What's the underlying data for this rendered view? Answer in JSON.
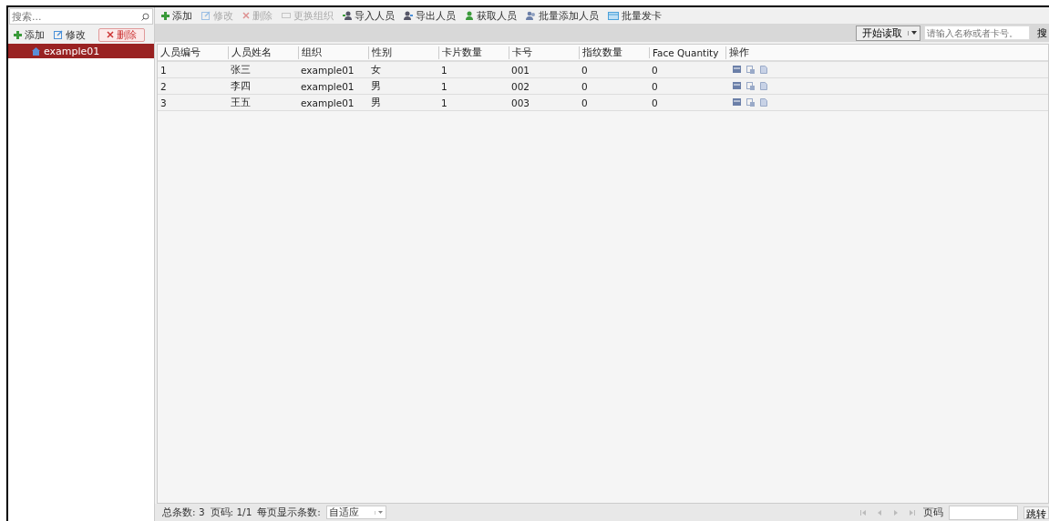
{
  "left_panel": {
    "search": {
      "placeholder": "搜索..."
    },
    "buttons": [
      {
        "label": "添加",
        "kind": "add"
      },
      {
        "label": "修改",
        "kind": "edit"
      },
      {
        "label": "删除",
        "kind": "delete"
      }
    ],
    "tree": [
      {
        "label": "example01",
        "selected": true
      }
    ]
  },
  "toolbar": [
    {
      "label": "添加",
      "kind": "add",
      "disabled": false
    },
    {
      "label": "修改",
      "kind": "edit",
      "disabled": true
    },
    {
      "label": "删除",
      "kind": "delete",
      "disabled": true
    },
    {
      "label": "更换组织",
      "kind": "move",
      "disabled": true
    },
    {
      "label": "导入人员",
      "kind": "import",
      "disabled": false
    },
    {
      "label": "导出人员",
      "kind": "export",
      "disabled": false
    },
    {
      "label": "获取人员",
      "kind": "fetch",
      "disabled": false
    },
    {
      "label": "批量添加人员",
      "kind": "batch",
      "disabled": false
    },
    {
      "label": "批量发卡",
      "kind": "card",
      "disabled": false
    }
  ],
  "reader": {
    "button": "开始读取",
    "search": {
      "placeholder": "请输入名称或者卡号。"
    },
    "search_button": "搜"
  },
  "table": {
    "columns": [
      "人员编号",
      "人员姓名",
      "组织",
      "性别",
      "卡片数量",
      "卡号",
      "指纹数量",
      "Face Quantity",
      "操作"
    ],
    "rows": [
      [
        "1",
        "张三",
        "example01",
        "女",
        "1",
        "001",
        "0",
        "0"
      ],
      [
        "2",
        "李四",
        "example01",
        "男",
        "1",
        "002",
        "0",
        "0"
      ],
      [
        "3",
        "王五",
        "example01",
        "男",
        "1",
        "003",
        "0",
        "0"
      ]
    ]
  },
  "footer": {
    "total": "总条数: 3",
    "page": "页码: 1/1",
    "per_page_label": "每页显示条数:",
    "per_page_value": "自适应",
    "page_label": "页码",
    "jump": "跳转"
  }
}
